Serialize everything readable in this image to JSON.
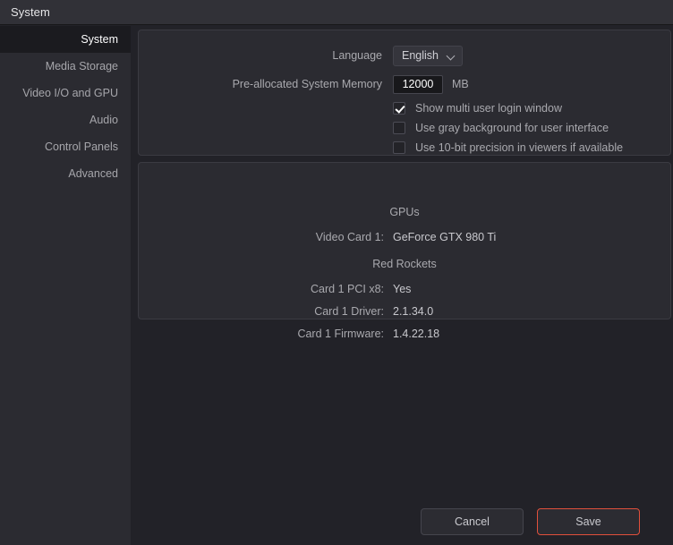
{
  "window": {
    "title": "System"
  },
  "sidebar": {
    "items": [
      {
        "label": "System"
      },
      {
        "label": "Media Storage"
      },
      {
        "label": "Video I/O and GPU"
      },
      {
        "label": "Audio"
      },
      {
        "label": "Control Panels"
      },
      {
        "label": "Advanced"
      }
    ],
    "active_index": 0
  },
  "settings": {
    "language": {
      "label": "Language",
      "value": "English",
      "icon": "chevron-down-icon"
    },
    "memory": {
      "label": "Pre-allocated System Memory",
      "value": "12000",
      "placeholder": "12000",
      "unit": "MB"
    },
    "checkboxes": [
      {
        "label": "Show multi user login window",
        "checked": true
      },
      {
        "label": "Use gray background for user interface",
        "checked": false
      },
      {
        "label": "Use 10-bit precision in viewers if available",
        "checked": false
      }
    ]
  },
  "hardware": {
    "gpus": {
      "title": "GPUs",
      "rows": [
        {
          "label": "Video Card 1:",
          "value": "GeForce GTX 980 Ti"
        }
      ]
    },
    "red_rockets": {
      "title": "Red Rockets",
      "rows": [
        {
          "label": "Card 1 PCI x8:",
          "value": "Yes"
        },
        {
          "label": "Card 1 Driver:",
          "value": "2.1.34.0"
        },
        {
          "label": "Card 1 Firmware:",
          "value": "1.4.22.18"
        }
      ]
    }
  },
  "footer": {
    "cancel_label": "Cancel",
    "save_label": "Save"
  },
  "colors": {
    "window_bg": "#222228",
    "panel_bg": "#2b2b31",
    "titlebar_bg": "#313137",
    "sidebar_active_bg": "#1b1b1f",
    "accent": "#e1503c",
    "text": "#a9a9ae",
    "text_bright": "#ffffff"
  }
}
